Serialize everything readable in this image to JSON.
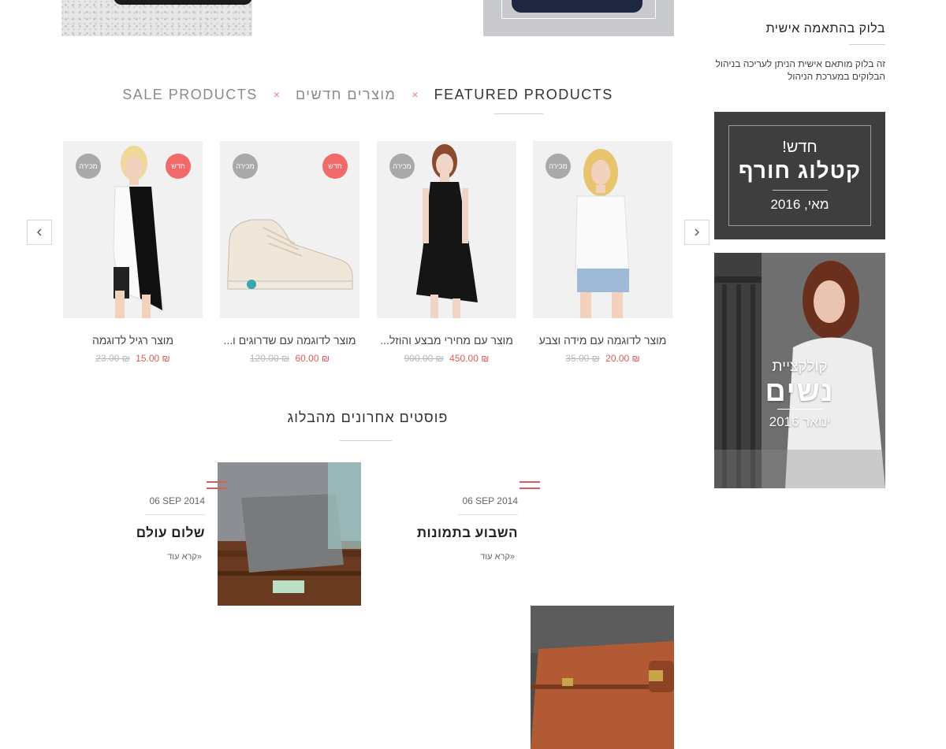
{
  "tabs": {
    "sale": "SALE PRODUCTS",
    "new": "מוצרים חדשים",
    "featured": "FEATURED PRODUCTS",
    "separator": "×"
  },
  "carousel": {
    "prev_icon": "chevron-left-icon",
    "next_icon": "chevron-right-icon"
  },
  "products": [
    {
      "name": "מוצר רגיל לדוגמה",
      "price": "₪ 15.00",
      "old_price": "₪ 23.00",
      "badge_sale": "מכירה",
      "badge_new": "חדש"
    },
    {
      "name": "מוצר לדוגמה עם שדרוגים ו...",
      "price": "₪ 60.00",
      "old_price": "₪ 120.00",
      "badge_sale": "מכירה",
      "badge_new": "חדש"
    },
    {
      "name": "מוצר עם מחירי מבצע והוזל...",
      "price": "₪ 450.00",
      "old_price": "₪ 900.00",
      "badge_sale": "מכירה"
    },
    {
      "name": "מוצר לדוגמה עם מידה וצבע",
      "price": "₪ 20.00",
      "old_price": "₪ 35.00",
      "badge_sale": "מכירה"
    }
  ],
  "blog": {
    "heading": "פוסטים אחרונים מהבלוג",
    "posts": [
      {
        "date": "06 SEP 2014",
        "title": "שלום עולם",
        "more": "«קרא עוד"
      },
      {
        "date": "06 SEP 2014",
        "title": "השבוע בתמונות",
        "more": "«קרא עוד"
      }
    ]
  },
  "sidebar": {
    "title": "בלוק בהתאמה אישית",
    "text": "זה בלוק מותאם אישית הניתן לעריכה בניהול הבלוקים במערכת הניהול",
    "catalog": {
      "small": "חדש!",
      "big": "קטלוג חורף",
      "date": "מאי, 2016"
    },
    "women": {
      "small": "קולקציית",
      "big": "נשים",
      "date": "ינואר 2016"
    }
  },
  "colors": {
    "accent": "#f06a6a",
    "price": "#e05a5a",
    "badge_sale": "#a9a9a9",
    "catalog_bg": "#3e3e3e"
  }
}
